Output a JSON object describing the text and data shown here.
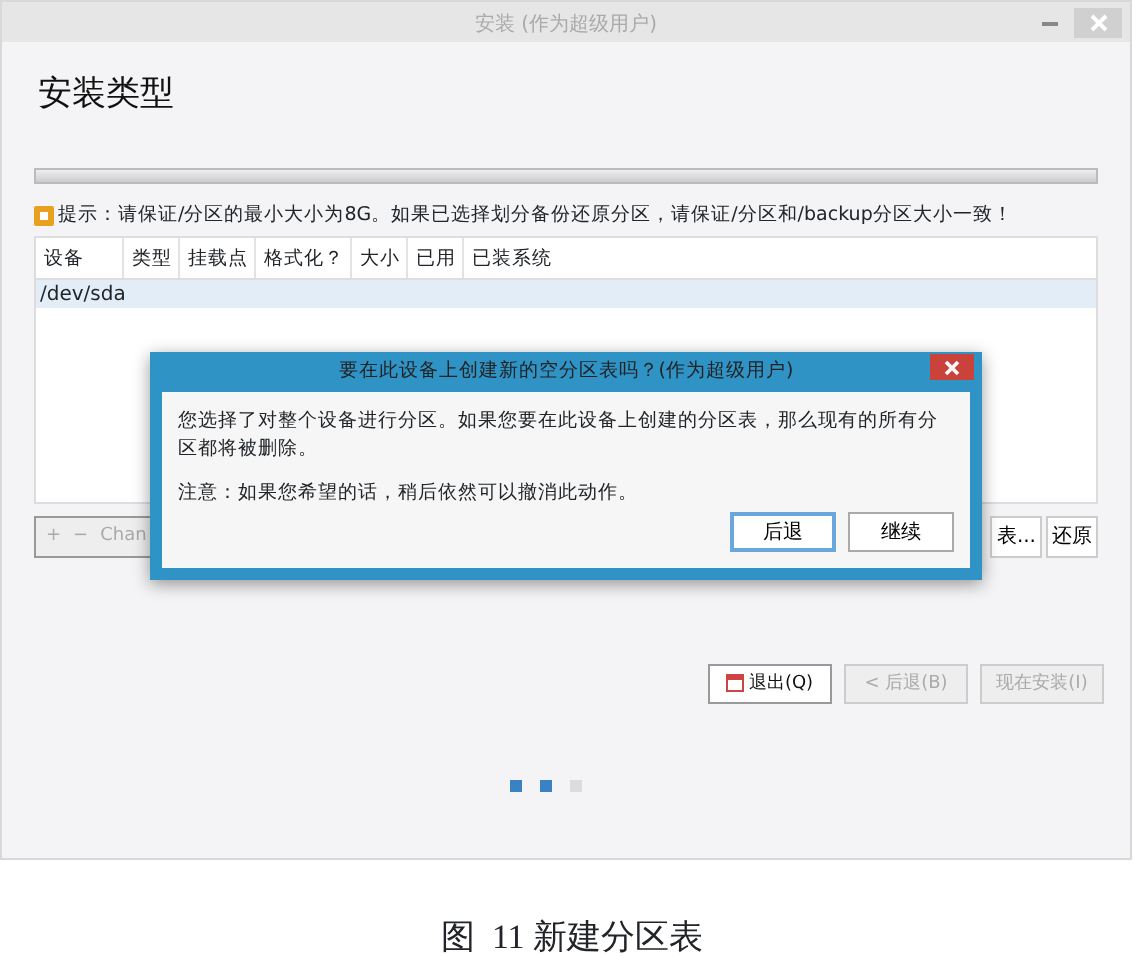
{
  "window": {
    "title": "安装 (作为超级用户)"
  },
  "page_title": "安装类型",
  "hint": "提示：请保证/分区的最小大小为8G。如果已选择划分备份还原分区，请保证/分区和/backup分区大小一致！",
  "table": {
    "columns": [
      "设备",
      "类型",
      "挂载点",
      "格式化？",
      "大小",
      "已用",
      "已装系统"
    ],
    "rows": [
      {
        "device": "/dev/sda",
        "selected": true
      }
    ]
  },
  "toolbar": {
    "left": [
      "+",
      "−",
      "Chan"
    ],
    "right": [
      {
        "label": "表...",
        "disabled": false
      },
      {
        "label": "还原",
        "disabled": false
      }
    ]
  },
  "dialog": {
    "title": "要在此设备上创建新的空分区表吗？(作为超级用户)",
    "message": "您选择了对整个设备进行分区。如果您要在此设备上创建的分区表，那么现有的所有分区都将被删除。",
    "note": "注意：如果您希望的话，稍后依然可以撤消此动作。",
    "buttons": [
      {
        "label": "后退",
        "default": true
      },
      {
        "label": "继续",
        "default": false
      }
    ]
  },
  "nav_buttons": [
    {
      "label": "退出(Q)",
      "disabled": false,
      "kind": "quit"
    },
    {
      "label": "< 后退(B)",
      "disabled": true,
      "kind": "plain"
    },
    {
      "label": "现在安装(I)",
      "disabled": true,
      "kind": "plain"
    }
  ],
  "steps": [
    {
      "done": true
    },
    {
      "done": true
    },
    {
      "done": false
    }
  ],
  "caption": "图  11 新建分区表"
}
